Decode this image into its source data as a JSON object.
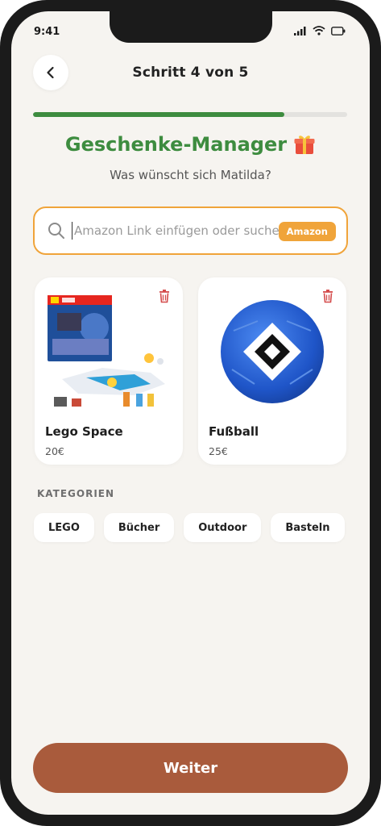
{
  "status_bar": {
    "time": "9:41"
  },
  "header": {
    "back_icon": "chevron-left-icon",
    "step_title": "Schritt 4 von 5",
    "progress": 0.8
  },
  "page": {
    "title": "Geschenke-Manager",
    "title_icon": "gift-icon",
    "subtitle": "Was wünscht sich Matilda?"
  },
  "search": {
    "placeholder": "Amazon Link einfügen oder suchen",
    "value": "",
    "amazon_label": "Amazon"
  },
  "gifts": [
    {
      "name": "Lego Space",
      "price": "20€",
      "image": "lego-space-set"
    },
    {
      "name": "Fußball",
      "price": "25€",
      "image": "blue-football"
    }
  ],
  "categories": {
    "label": "KATEGORIEN",
    "items": [
      "LEGO",
      "Bücher",
      "Outdoor",
      "Basteln"
    ]
  },
  "footer": {
    "next_label": "Weiter"
  },
  "colors": {
    "green": "#3d8c3f",
    "orange": "#f0a43a",
    "brown": "#a95b3c",
    "background": "#f6f4f0",
    "trash_red": "#d44b4b"
  }
}
